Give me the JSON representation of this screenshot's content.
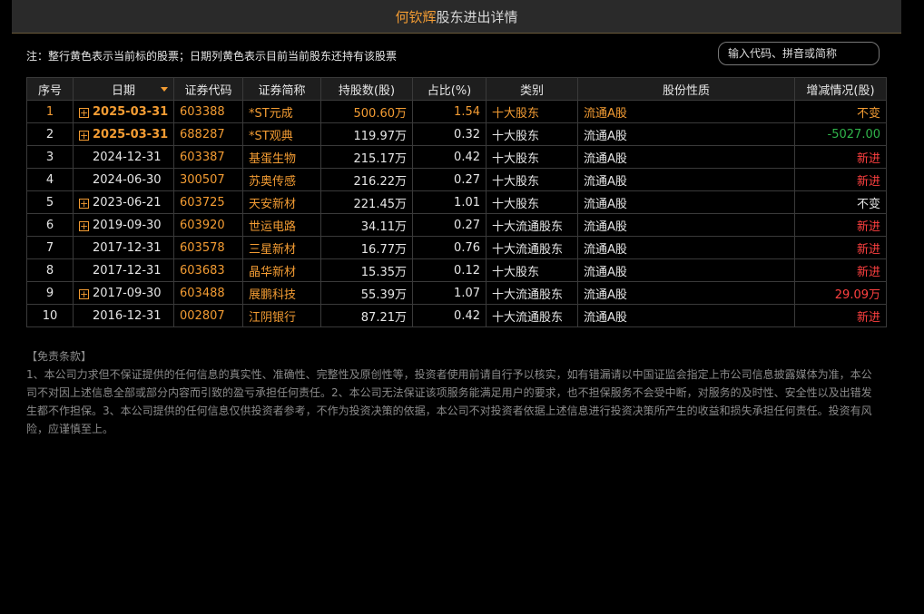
{
  "header": {
    "name": "何钦辉",
    "rest": "股东进出详情"
  },
  "note": "注：整行黄色表示当前标的股票；日期列黄色表示目前当前股东还持有该股票",
  "search": {
    "placeholder": "输入代码、拼音或简称"
  },
  "table": {
    "columns": [
      "序号",
      "日期",
      "证券代码",
      "证券简称",
      "持股数(股)",
      "占比(%)",
      "类别",
      "股份性质",
      "增减情况(股)"
    ],
    "rows": [
      {
        "no": "1",
        "expand": true,
        "date": "2025-03-31",
        "code": "603388",
        "name": "*ST元成",
        "shares": "500.60万",
        "ratio": "1.54",
        "type": "十大股东",
        "nature": "流通A股",
        "change": "不变",
        "highlight": "row",
        "change_color": "#f39c33"
      },
      {
        "no": "2",
        "expand": true,
        "date": "2025-03-31",
        "code": "688287",
        "name": "*ST观典",
        "shares": "119.97万",
        "ratio": "0.32",
        "type": "十大股东",
        "nature": "流通A股",
        "change": "-5027.00",
        "highlight": "date",
        "change_color": "#2fb34a"
      },
      {
        "no": "3",
        "expand": false,
        "date": "2024-12-31",
        "code": "603387",
        "name": "基蛋生物",
        "shares": "215.17万",
        "ratio": "0.42",
        "type": "十大股东",
        "nature": "流通A股",
        "change": "新进",
        "highlight": "none",
        "change_color": "#ff4040"
      },
      {
        "no": "4",
        "expand": false,
        "date": "2024-06-30",
        "code": "300507",
        "name": "苏奥传感",
        "shares": "216.22万",
        "ratio": "0.27",
        "type": "十大股东",
        "nature": "流通A股",
        "change": "新进",
        "highlight": "none",
        "change_color": "#ff4040"
      },
      {
        "no": "5",
        "expand": true,
        "date": "2023-06-21",
        "code": "603725",
        "name": "天安新材",
        "shares": "221.45万",
        "ratio": "1.01",
        "type": "十大股东",
        "nature": "流通A股",
        "change": "不变",
        "highlight": "none",
        "change_color": "#e6e6e6"
      },
      {
        "no": "6",
        "expand": true,
        "date": "2019-09-30",
        "code": "603920",
        "name": "世运电路",
        "shares": "34.11万",
        "ratio": "0.27",
        "type": "十大流通股东",
        "nature": "流通A股",
        "change": "新进",
        "highlight": "none",
        "change_color": "#ff4040"
      },
      {
        "no": "7",
        "expand": false,
        "date": "2017-12-31",
        "code": "603578",
        "name": "三星新材",
        "shares": "16.77万",
        "ratio": "0.76",
        "type": "十大流通股东",
        "nature": "流通A股",
        "change": "新进",
        "highlight": "none",
        "change_color": "#ff4040"
      },
      {
        "no": "8",
        "expand": false,
        "date": "2017-12-31",
        "code": "603683",
        "name": "晶华新材",
        "shares": "15.35万",
        "ratio": "0.12",
        "type": "十大股东",
        "nature": "流通A股",
        "change": "新进",
        "highlight": "none",
        "change_color": "#ff4040"
      },
      {
        "no": "9",
        "expand": true,
        "date": "2017-09-30",
        "code": "603488",
        "name": "展鹏科技",
        "shares": "55.39万",
        "ratio": "1.07",
        "type": "十大流通股东",
        "nature": "流通A股",
        "change": "29.09万",
        "highlight": "none",
        "change_color": "#ff4040"
      },
      {
        "no": "10",
        "expand": false,
        "date": "2016-12-31",
        "code": "002807",
        "name": "江阴银行",
        "shares": "87.21万",
        "ratio": "0.42",
        "type": "十大流通股东",
        "nature": "流通A股",
        "change": "新进",
        "highlight": "none",
        "change_color": "#ff4040"
      }
    ]
  },
  "disclaimer": {
    "title": "【免责条款】",
    "text": "1、本公司力求但不保证提供的任何信息的真实性、准确性、完整性及原创性等，投资者使用前请自行予以核实，如有错漏请以中国证监会指定上市公司信息披露媒体为准，本公司不对因上述信息全部或部分内容而引致的盈亏承担任何责任。2、本公司无法保证该项服务能满足用户的要求，也不担保服务不会受中断，对服务的及时性、安全性以及出错发生都不作担保。3、本公司提供的任何信息仅供投资者参考，不作为投资决策的依据，本公司不对投资者依据上述信息进行投资决策所产生的收益和损失承担任何责任。投资有风险，应谨慎至上。"
  },
  "colors": {
    "accent": "#f39c33",
    "up": "#ff4040",
    "down": "#2fb34a"
  }
}
